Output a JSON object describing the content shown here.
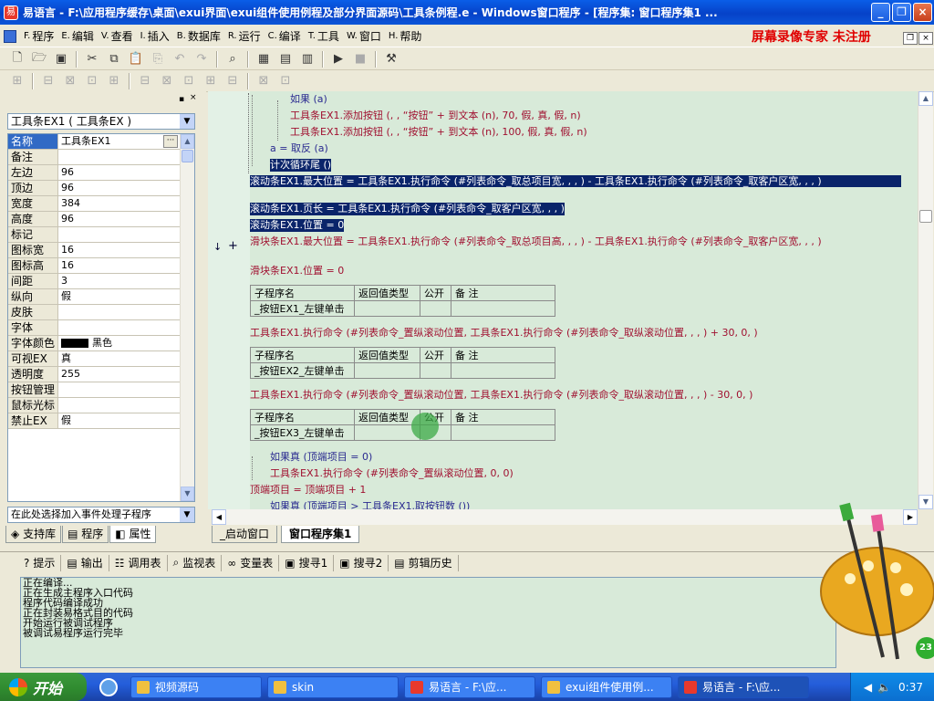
{
  "window": {
    "title": "易语言 - F:\\应用程序缓存\\桌面\\exui界面\\exui组件使用例程及部分界面源码\\工具条例程.e - Windows窗口程序 - [程序集: 窗口程序集1 ...",
    "app_icon": "易",
    "min": "_",
    "max": "❐",
    "close": "×"
  },
  "menu": [
    {
      "acc": "F.",
      "label": "程序"
    },
    {
      "acc": "E.",
      "label": "编辑"
    },
    {
      "acc": "V.",
      "label": "查看"
    },
    {
      "acc": "I.",
      "label": "插入"
    },
    {
      "acc": "B.",
      "label": "数据库"
    },
    {
      "acc": "R.",
      "label": "运行"
    },
    {
      "acc": "C.",
      "label": "编译"
    },
    {
      "acc": "T.",
      "label": "工具"
    },
    {
      "acc": "W.",
      "label": "窗口"
    },
    {
      "acc": "H.",
      "label": "帮助"
    }
  ],
  "watermark": "屏幕录像专家  未注册",
  "left_panel": {
    "component_select": "工具条EX1 ( 工具条EX )",
    "properties": [
      {
        "name": "名称",
        "value": "工具条EX1"
      },
      {
        "name": "备注",
        "value": ""
      },
      {
        "name": "左边",
        "value": "96"
      },
      {
        "name": "顶边",
        "value": "96"
      },
      {
        "name": "宽度",
        "value": "384"
      },
      {
        "name": "高度",
        "value": "96"
      },
      {
        "name": "标记",
        "value": ""
      },
      {
        "name": "图标宽",
        "value": "16"
      },
      {
        "name": "图标高",
        "value": "16"
      },
      {
        "name": "间距",
        "value": "3"
      },
      {
        "name": "纵向",
        "value": "假"
      },
      {
        "name": "皮肤",
        "value": ""
      },
      {
        "name": "字体",
        "value": ""
      },
      {
        "name": "字体颜色",
        "value": "黑色"
      },
      {
        "name": "可视EX",
        "value": "真"
      },
      {
        "name": "透明度",
        "value": "255"
      },
      {
        "name": "按钮管理",
        "value": ""
      },
      {
        "name": "鼠标光标",
        "value": ""
      },
      {
        "name": "禁止EX",
        "value": "假"
      }
    ],
    "event_select": "在此处选择加入事件处理子程序",
    "tabs": [
      "支持库",
      "程序",
      "属性"
    ]
  },
  "editor": {
    "lines": [
      {
        "text": "如果 (a)",
        "style": "kw"
      },
      {
        "text": "工具条EX1.添加按钮 (, , “按钮” + 到文本 (n), 70, 假, 真, 假, n)",
        "style": "red"
      },
      {
        "text": "工具条EX1.添加按钮 (, , “按钮” + 到文本 (n), 100, 假, 真, 假, n)",
        "style": "red"
      },
      {
        "text": "a = 取反 (a)",
        "style": "kw"
      },
      {
        "text": "计次循环尾 ()",
        "style": "hl"
      },
      {
        "text": "滚动条EX1.最大位置 = 工具条EX1.执行命令 (#列表命令_取总项目宽, , , ) - 工具条EX1.执行命令 (#列表命令_取客户区宽, , , )",
        "style": "hl"
      },
      {
        "text": "滚动条EX1.页长 = 工具条EX1.执行命令 (#列表命令_取客户区宽, , , )",
        "style": "hl"
      },
      {
        "text": "滚动条EX1.位置 = 0",
        "style": "hl"
      },
      {
        "text": "滑块条EX1.最大位置 = 工具条EX1.执行命令 (#列表命令_取总项目高, , , ) - 工具条EX1.执行命令 (#列表命令_取客户区宽, , , )",
        "style": "red"
      },
      {
        "text": "滑块条EX1.位置 = 0",
        "style": "red"
      },
      {
        "text": "工具条EX1.执行命令 (#列表命令_置纵滚动位置, 工具条EX1.执行命令 (#列表命令_取纵滚动位置, , , ) + 30, 0, )",
        "style": "red"
      },
      {
        "text": "工具条EX1.执行命令 (#列表命令_置纵滚动位置, 工具条EX1.执行命令 (#列表命令_取纵滚动位置, , , ) - 30, 0, )",
        "style": "red"
      },
      {
        "text": "如果真 (顶端项目 = 0)",
        "style": "kw"
      },
      {
        "text": "工具条EX1.执行命令 (#列表命令_置纵滚动位置, 0, 0)",
        "style": "red"
      },
      {
        "text": "顶端项目 = 顶端项目 + 1",
        "style": "red"
      },
      {
        "text": "如果真 (顶端项目 > 工具条EX1.取按钮数 ())",
        "style": "kw"
      }
    ],
    "sub_headers": {
      "name": "子程序名",
      "ret": "返回值类型",
      "public": "公开",
      "note": "备 注"
    },
    "subs": [
      "_按钮EX1_左键单击",
      "_按钮EX2_左键单击",
      "_按钮EX3_左键单击"
    ],
    "tabs": [
      "_启动窗口",
      "窗口程序集1"
    ]
  },
  "bottom_tabs": [
    {
      "icon": "?",
      "label": "提示"
    },
    {
      "icon": "▤",
      "label": "输出"
    },
    {
      "icon": "☷",
      "label": "调用表"
    },
    {
      "icon": "⌕",
      "label": "监视表"
    },
    {
      "icon": "∞",
      "label": "变量表"
    },
    {
      "icon": "▣",
      "label": "搜寻1"
    },
    {
      "icon": "▣",
      "label": "搜寻2"
    },
    {
      "icon": "▤",
      "label": "剪辑历史"
    }
  ],
  "output_lines": [
    "正在编译...",
    "正在生成主程序入口代码",
    "程序代码编译成功",
    "正在封装易格式目的代码",
    "开始运行被调试程序",
    "被调试易程序运行完毕"
  ],
  "taskbar": {
    "start": "开始",
    "items": [
      "视频源码",
      "skin",
      "易语言 - F:\\应...",
      "exui组件使用例...",
      "易语言 - F:\\应..."
    ],
    "clock": "0:37",
    "badge": "23"
  }
}
